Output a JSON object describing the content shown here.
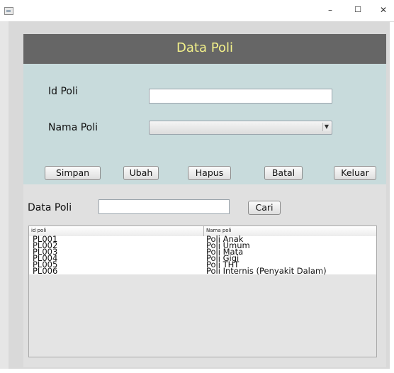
{
  "window": {
    "controls": {
      "minimize": "–",
      "maximize": "☐",
      "close": "✕"
    }
  },
  "header": {
    "title": "Data Poli"
  },
  "form": {
    "id_label": "Id Poli",
    "id_value": "",
    "nama_label": "Nama Poli",
    "nama_selected": ""
  },
  "buttons": {
    "simpan": "Simpan",
    "ubah": "Ubah",
    "hapus": "Hapus",
    "batal": "Batal",
    "keluar": "Keluar"
  },
  "search": {
    "label": "Data Poli",
    "value": "",
    "button": "Cari"
  },
  "table": {
    "columns": [
      "id poli",
      "Nama poli"
    ],
    "rows": [
      [
        "PL001",
        "Poli Anak"
      ],
      [
        "PL002",
        "Poli Umum"
      ],
      [
        "PL003",
        "Poli Mata"
      ],
      [
        "PL004",
        "Poli Gigi"
      ],
      [
        "PL005",
        "Poli THT"
      ],
      [
        "PL006",
        "Poli Internis (Penyakit Dalam)"
      ]
    ]
  },
  "colors": {
    "header_bg": "#666666",
    "header_text": "#f2f08a",
    "form_bg": "#c8dbdc"
  }
}
